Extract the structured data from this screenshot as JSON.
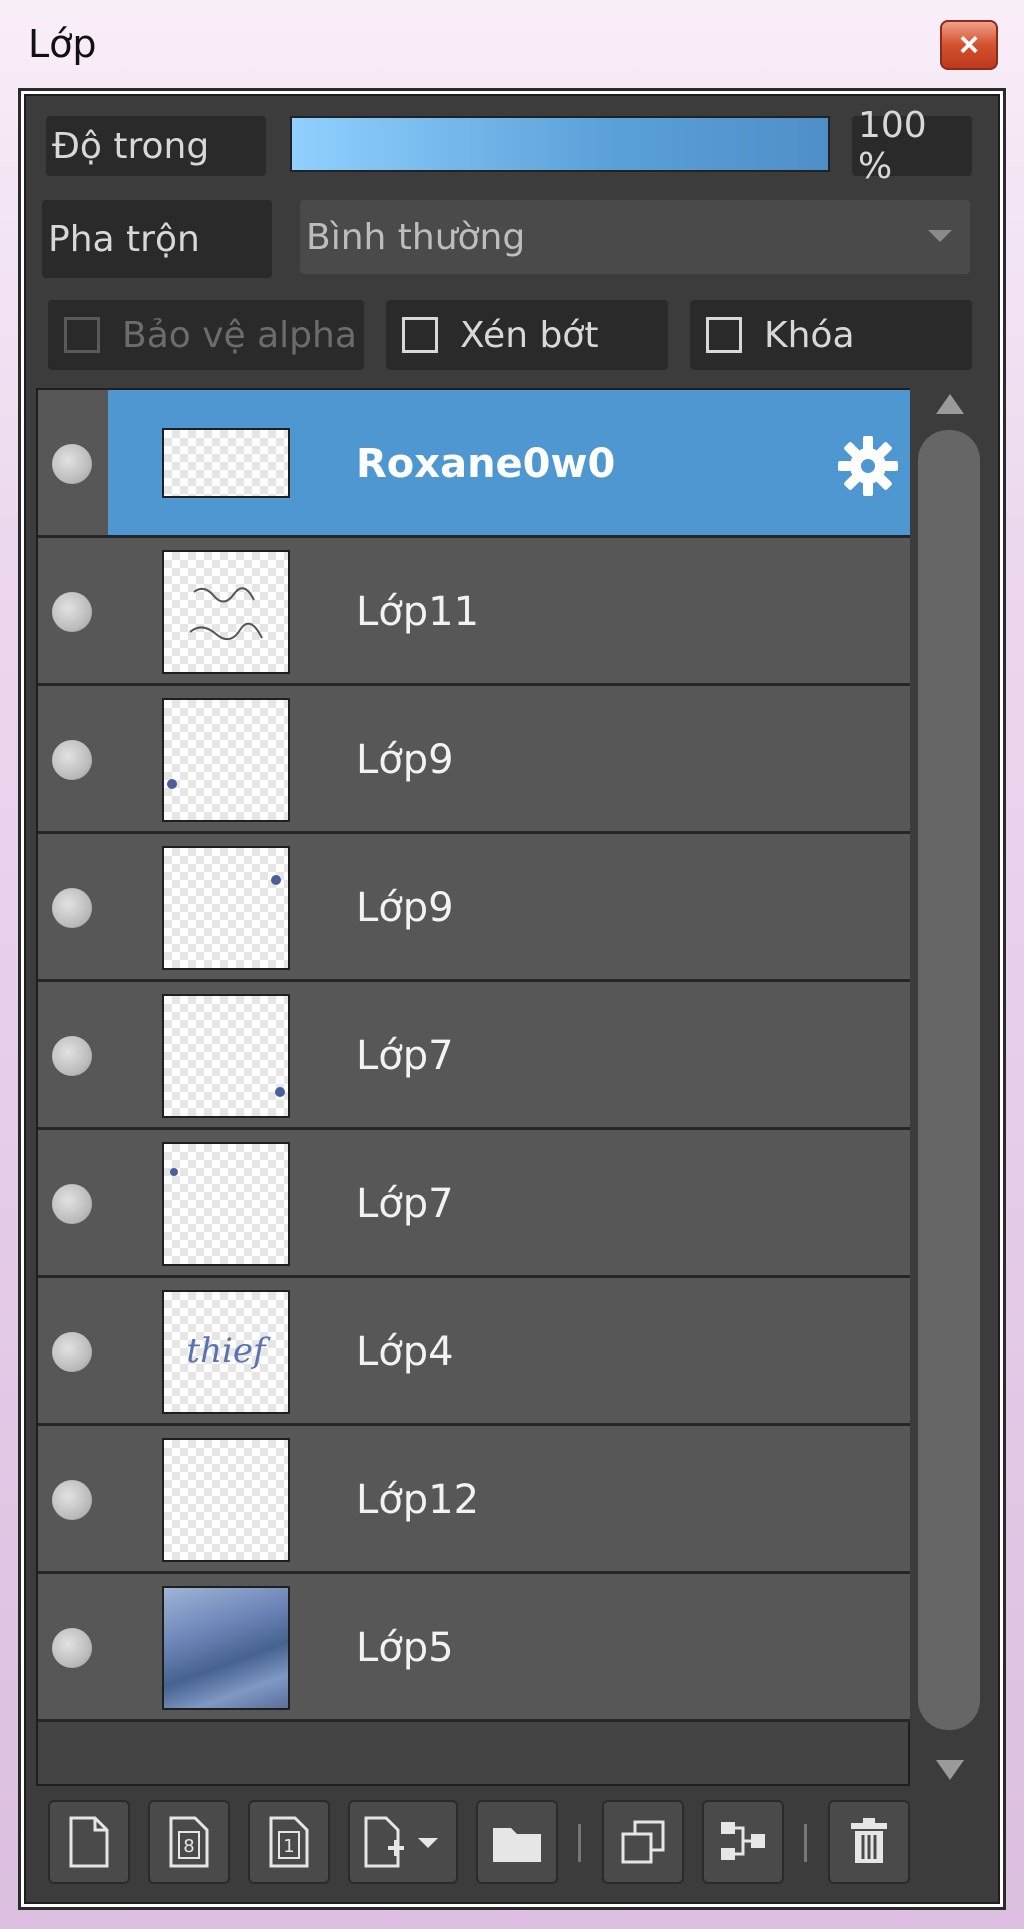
{
  "window": {
    "title": "Lớp",
    "close_glyph": "×"
  },
  "controls": {
    "opacity_label": "Độ trong",
    "opacity_value": "100 %",
    "opacity_fraction": 1.0,
    "blend_label": "Pha trộn",
    "blend_mode": "Bình thường",
    "protect_alpha": "Bảo vệ alpha",
    "clip": "Xén bớt",
    "lock": "Khóa"
  },
  "layers": [
    {
      "name": "Roxane0w0",
      "selected": true
    },
    {
      "name": "Lớp11"
    },
    {
      "name": "Lớp9"
    },
    {
      "name": "Lớp9"
    },
    {
      "name": "Lớp7"
    },
    {
      "name": "Lớp7"
    },
    {
      "name": "Lớp4",
      "thumb_text": "thief"
    },
    {
      "name": "Lớp12"
    },
    {
      "name": "Lớp5"
    }
  ],
  "toolbar": {
    "icons": [
      "new-layer-icon",
      "new-8bit-layer-icon",
      "new-1bit-layer-icon",
      "add-layer-dropdown-icon",
      "folder-icon",
      "duplicate-icon",
      "merge-down-icon",
      "trash-icon"
    ]
  },
  "colors": {
    "selection": "#4f97d1",
    "panel": "#3c3c3c",
    "row": "#575757",
    "close": "#d3502f"
  }
}
